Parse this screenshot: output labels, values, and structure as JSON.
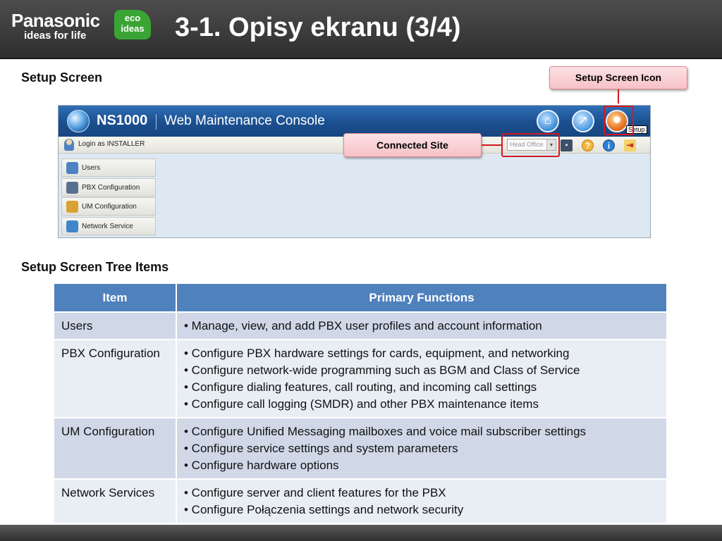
{
  "header": {
    "brand": "Panasonic",
    "tagline": "ideas for life",
    "eco_line1": "eco",
    "eco_line2": "ideas",
    "title": "3-1. Opisy ekranu (3/4)"
  },
  "setup_section": {
    "title": "Setup Screen",
    "callout_icon": "Setup Screen Icon",
    "callout_site": "Connected Site"
  },
  "console": {
    "product": "NS1000",
    "app_name": "Web Maintenance Console",
    "setup_tooltip": "Setup",
    "login_text": "Login as INSTALLER",
    "site_value": "Head Office",
    "icons": {
      "home": "home-icon",
      "tools": "tools-icon",
      "setup": "setup-gear-icon",
      "save": "save-icon",
      "help": "help-icon",
      "info": "info-icon",
      "logout": "logout-icon"
    },
    "nav": [
      {
        "label": "Users",
        "icon": "users-icon",
        "color": "#4f82c4"
      },
      {
        "label": "PBX Configuration",
        "icon": "pbx-configuration-icon",
        "color": "#5a6f8f"
      },
      {
        "label": "UM Configuration",
        "icon": "um-configuration-icon",
        "color": "#d9a234"
      },
      {
        "label": "Network Service",
        "icon": "network-service-icon",
        "color": "#3f86c9"
      }
    ]
  },
  "tree_section": {
    "title": "Setup Screen Tree Items",
    "table": {
      "headers": [
        "Item",
        "Primary Functions"
      ],
      "rows": [
        {
          "item": "Users",
          "functions": [
            "• Manage, view, and add PBX user profiles and account information"
          ]
        },
        {
          "item": "PBX Configuration",
          "functions": [
            "• Configure PBX hardware settings for cards, equipment, and networking",
            "• Configure network-wide programming such as BGM and Class of Service",
            "• Configure dialing features, call routing, and incoming call settings",
            "• Configure call logging (SMDR) and other PBX maintenance items"
          ]
        },
        {
          "item": "UM Configuration",
          "functions": [
            "• Configure Unified Messaging mailboxes and voice mail subscriber settings",
            "• Configure service settings and system parameters",
            "• Configure hardware options"
          ]
        },
        {
          "item": "Network Services",
          "functions": [
            "• Configure server and client features for the PBX",
            "• Configure Połączenia settings and network security"
          ]
        }
      ]
    }
  },
  "colors": {
    "accent": "#4f81bd",
    "callout_border": "#d4181f"
  }
}
